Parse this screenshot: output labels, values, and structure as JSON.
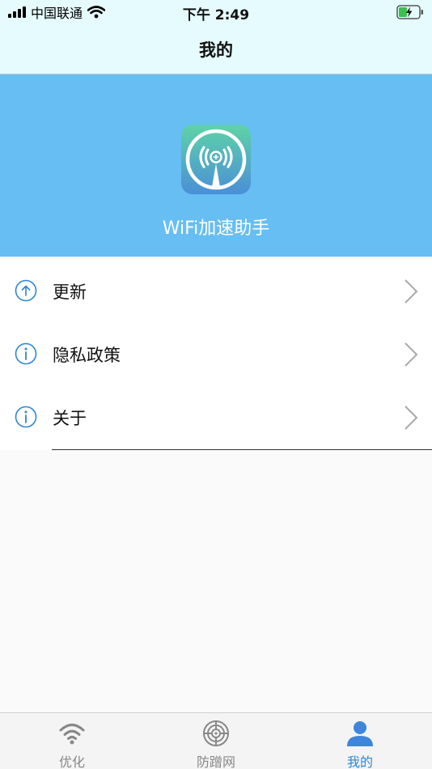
{
  "status_bar": {
    "carrier": "中国联通",
    "time": "下午 2:49",
    "icons": [
      "signal-icon",
      "wifi-icon",
      "battery-charging-icon"
    ]
  },
  "nav": {
    "title": "我的"
  },
  "header": {
    "app_name": "WiFi加速助手",
    "logo_icon": "wifi-antenna-logo"
  },
  "menu": {
    "items": [
      {
        "label": "更新",
        "icon": "upload-arrow-icon"
      },
      {
        "label": "隐私政策",
        "icon": "info-icon"
      },
      {
        "label": "关于",
        "icon": "info-icon"
      }
    ]
  },
  "tabs": {
    "items": [
      {
        "label": "优化",
        "icon": "wifi-icon",
        "active": false
      },
      {
        "label": "防蹭网",
        "icon": "crosshair-icon",
        "active": false
      },
      {
        "label": "我的",
        "icon": "user-icon",
        "active": true
      }
    ]
  },
  "colors": {
    "accent": "#2f86d6",
    "header_bg": "#66bef3",
    "nav_bg": "#e6fbfd",
    "inactive_tab": "#888888"
  }
}
